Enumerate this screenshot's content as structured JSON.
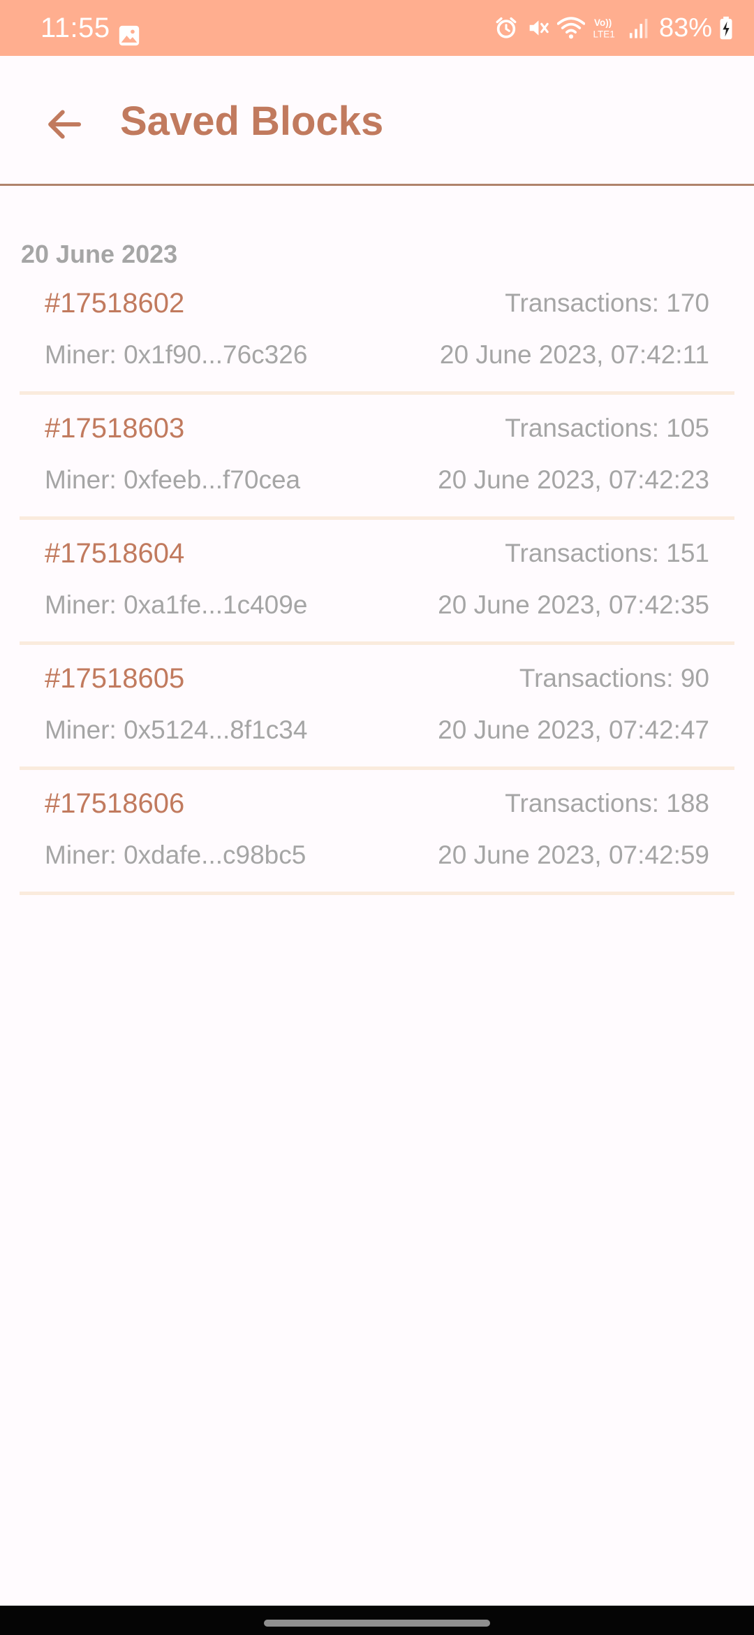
{
  "status_bar": {
    "time": "11:55",
    "battery": "83%",
    "icons": [
      "image-icon",
      "alarm-icon",
      "mute-icon",
      "wifi-icon",
      "volte-icon",
      "signal-icon",
      "battery-charging-icon"
    ],
    "background": "#FFAE8F"
  },
  "app_bar": {
    "title": "Saved Blocks",
    "back_icon": "arrow-left-icon",
    "accent": "#C17A5E"
  },
  "list": {
    "date_header": "20 June 2023",
    "blocks": [
      {
        "number": "#17518602",
        "transactions": "Transactions: 170",
        "miner": "Miner: 0x1f90...76c326",
        "time": "20 June 2023, 07:42:11"
      },
      {
        "number": "#17518603",
        "transactions": "Transactions: 105",
        "miner": "Miner: 0xfeeb...f70cea",
        "time": "20 June 2023, 07:42:23"
      },
      {
        "number": "#17518604",
        "transactions": "Transactions: 151",
        "miner": "Miner: 0xa1fe...1c409e",
        "time": "20 June 2023, 07:42:35"
      },
      {
        "number": "#17518605",
        "transactions": "Transactions: 90",
        "miner": "Miner: 0x5124...8f1c34",
        "time": "20 June 2023, 07:42:47"
      },
      {
        "number": "#17518606",
        "transactions": "Transactions: 188",
        "miner": "Miner: 0xdafe...c98bc5",
        "time": "20 June 2023, 07:42:59"
      }
    ]
  }
}
